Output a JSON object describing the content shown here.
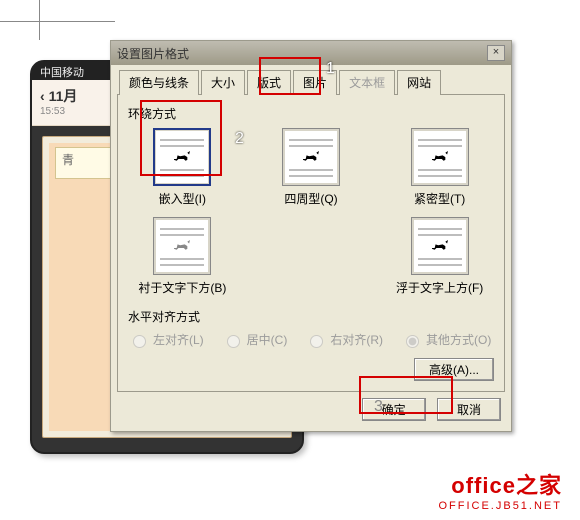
{
  "phone": {
    "carrier": "中国移动",
    "title": "11月",
    "time": "15:53",
    "placeholder": "青"
  },
  "dialog": {
    "title": "设置图片格式",
    "tabs": {
      "colors": "颜色与线条",
      "size": "大小",
      "layout": "版式",
      "picture": "图片",
      "textbox": "文本框",
      "web": "网站"
    },
    "wrap": {
      "group_label": "环绕方式",
      "inline": "嵌入型(I)",
      "square": "四周型(Q)",
      "tight": "紧密型(T)",
      "behind": "衬于文字下方(B)",
      "infront": "浮于文字上方(F)"
    },
    "halign": {
      "group_label": "水平对齐方式",
      "left": "左对齐(L)",
      "center": "居中(C)",
      "right": "右对齐(R)",
      "other": "其他方式(O)"
    },
    "advanced": "高级(A)...",
    "ok": "确定",
    "cancel": "取消"
  },
  "annotations": {
    "n1": "1",
    "n2": "2",
    "n3": "3"
  },
  "watermark": {
    "line1a": "office",
    "line1b": "之家",
    "line2": "OFFICE.JB51.NET"
  }
}
